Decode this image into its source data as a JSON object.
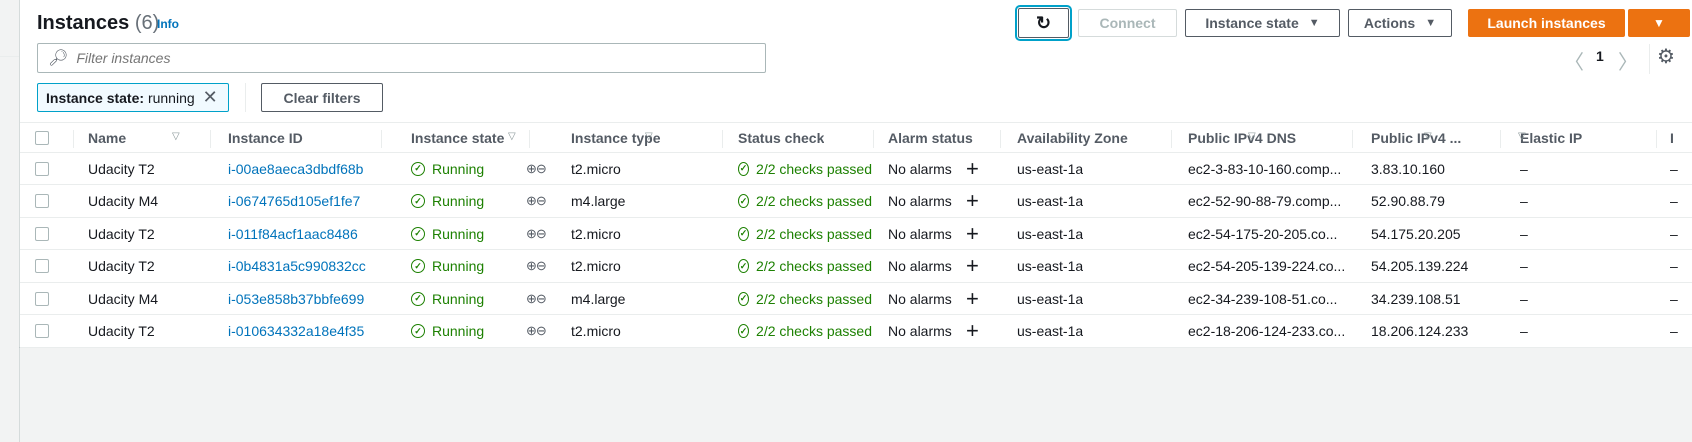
{
  "header": {
    "title": "Instances",
    "count": "(6)",
    "info": "Info"
  },
  "toolbar": {
    "connect": "Connect",
    "instance_state": "Instance state",
    "actions": "Actions",
    "launch": "Launch instances"
  },
  "filter": {
    "placeholder": "Filter instances",
    "chip_key": "Instance state:",
    "chip_value": "running",
    "clear": "Clear filters"
  },
  "pagination": {
    "page": "1"
  },
  "columns": [
    "Name",
    "Instance ID",
    "Instance state",
    "Instance type",
    "Status check",
    "Alarm status",
    "Availability Zone",
    "Public IPv4 DNS",
    "Public IPv4 ...",
    "Elastic IP",
    "I"
  ],
  "rows": [
    {
      "name": "Udacity T2",
      "id": "i-00ae8aeca3dbdf68b",
      "state": "Running",
      "type": "t2.micro",
      "status": "2/2 checks passed",
      "alarm": "No alarms",
      "az": "us-east-1a",
      "dns": "ec2-3-83-10-160.comp...",
      "ip": "3.83.10.160",
      "eip": "–",
      "next": "–"
    },
    {
      "name": "Udacity M4",
      "id": "i-0674765d105ef1fe7",
      "state": "Running",
      "type": "m4.large",
      "status": "2/2 checks passed",
      "alarm": "No alarms",
      "az": "us-east-1a",
      "dns": "ec2-52-90-88-79.comp...",
      "ip": "52.90.88.79",
      "eip": "–",
      "next": "–"
    },
    {
      "name": "Udacity T2",
      "id": "i-011f84acf1aac8486",
      "state": "Running",
      "type": "t2.micro",
      "status": "2/2 checks passed",
      "alarm": "No alarms",
      "az": "us-east-1a",
      "dns": "ec2-54-175-20-205.co...",
      "ip": "54.175.20.205",
      "eip": "–",
      "next": "–"
    },
    {
      "name": "Udacity T2",
      "id": "i-0b4831a5c990832cc",
      "state": "Running",
      "type": "t2.micro",
      "status": "2/2 checks passed",
      "alarm": "No alarms",
      "az": "us-east-1a",
      "dns": "ec2-54-205-139-224.co...",
      "ip": "54.205.139.224",
      "eip": "–",
      "next": "–"
    },
    {
      "name": "Udacity M4",
      "id": "i-053e858b37bbfe699",
      "state": "Running",
      "type": "m4.large",
      "status": "2/2 checks passed",
      "alarm": "No alarms",
      "az": "us-east-1a",
      "dns": "ec2-34-239-108-51.co...",
      "ip": "34.239.108.51",
      "eip": "–",
      "next": "–"
    },
    {
      "name": "Udacity T2",
      "id": "i-010634332a18e4f35",
      "state": "Running",
      "type": "t2.micro",
      "status": "2/2 checks passed",
      "alarm": "No alarms",
      "az": "us-east-1a",
      "dns": "ec2-18-206-124-233.co...",
      "ip": "18.206.124.233",
      "eip": "–",
      "next": "–"
    }
  ],
  "colors": {
    "accent": "#ec7211",
    "link": "#0073bb",
    "success": "#1d8102"
  }
}
